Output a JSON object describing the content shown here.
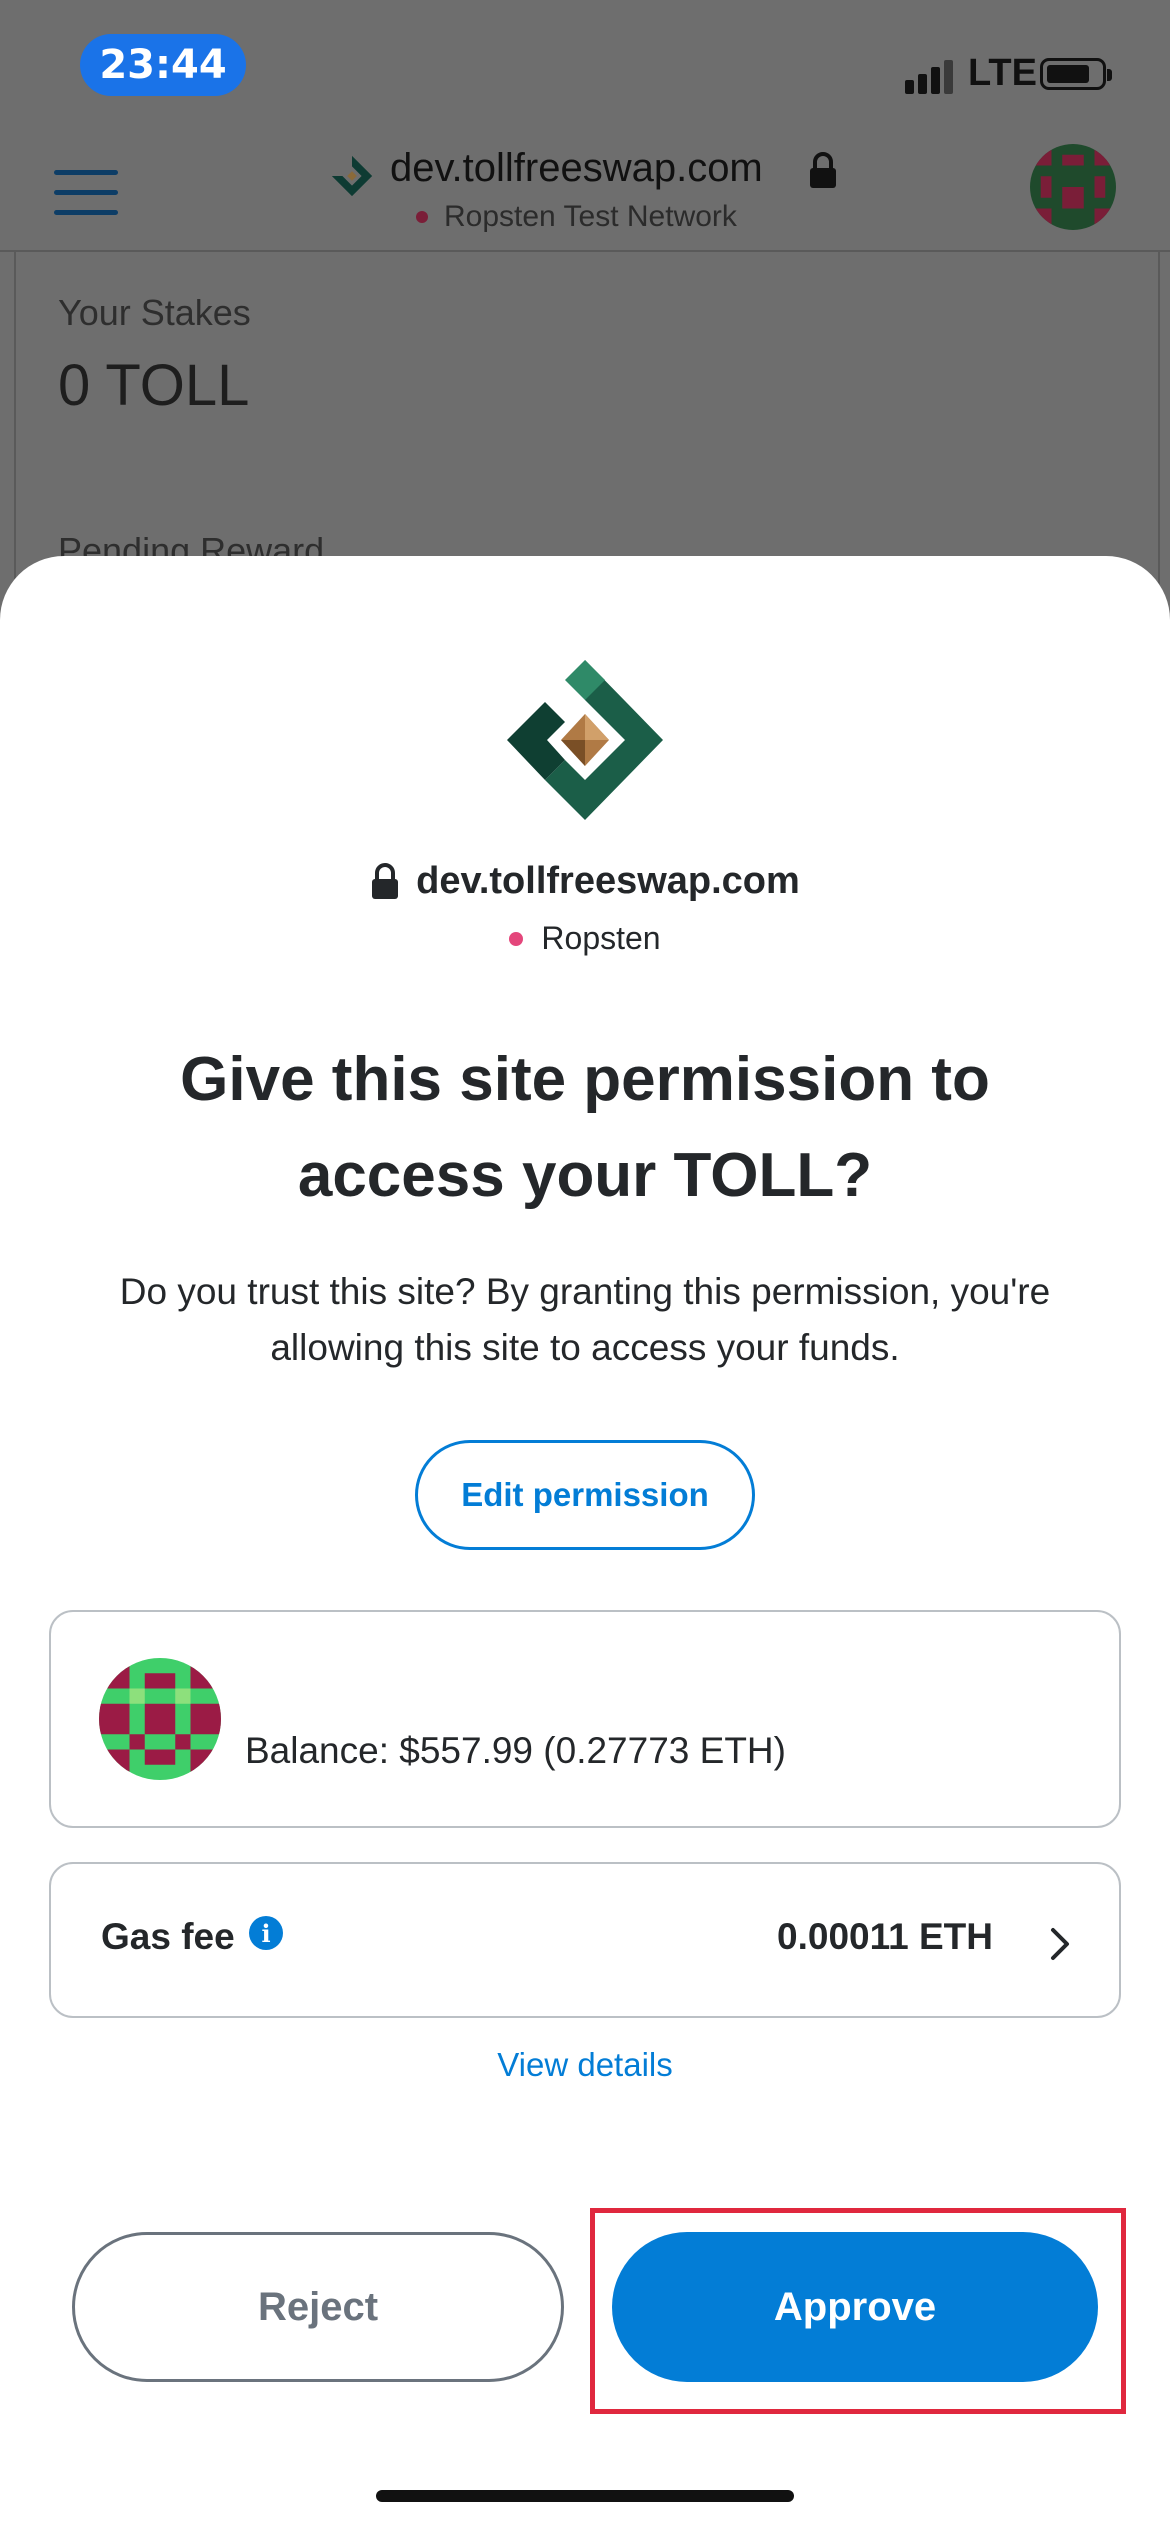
{
  "status_bar": {
    "time": "23:44",
    "network": "LTE"
  },
  "browser": {
    "url": "dev.tollfreeswap.com",
    "network": "Ropsten Test Network"
  },
  "page": {
    "stakes_label": "Your Stakes",
    "stakes_value": "0 TOLL",
    "pending_label": "Pending Reward"
  },
  "dialog": {
    "site_url": "dev.tollfreeswap.com",
    "network": "Ropsten",
    "title": "Give this site permission to access your TOLL?",
    "description": "Do you trust this site? By granting this permission, you're allowing this site to access your funds.",
    "edit_permission_label": "Edit permission",
    "account": {
      "balance": "Balance: $557.99 (0.27773 ETH)"
    },
    "gas": {
      "label": "Gas fee",
      "value": "0.00011 ETH"
    },
    "view_details_label": "View details",
    "reject_label": "Reject",
    "approve_label": "Approve"
  },
  "colors": {
    "accent": "#037dd6",
    "highlight": "#e0283e",
    "network_dot": "#e4467b"
  },
  "icons": [
    "menu-icon",
    "lock-icon",
    "site-logo-icon",
    "info-icon",
    "chevron-right-icon",
    "account-avatar-icon"
  ]
}
